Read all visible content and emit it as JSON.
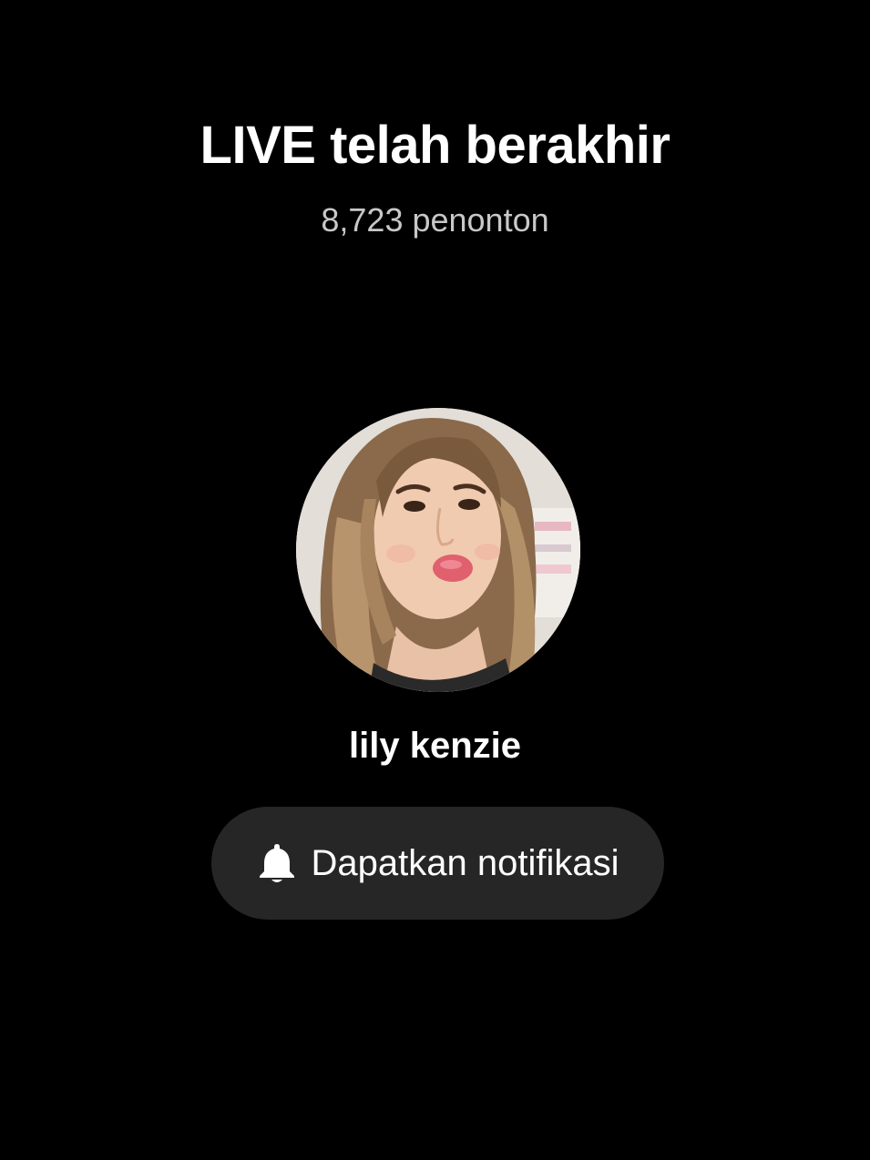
{
  "live_ended": {
    "title": "LIVE telah berakhir",
    "viewers": "8,723 penonton"
  },
  "host": {
    "name": "lily kenzie",
    "avatar_icon": "profile-photo"
  },
  "notify_button": {
    "label": "Dapatkan notifikasi",
    "icon": "bell-icon"
  },
  "colors": {
    "background": "#000000",
    "text_primary": "#ffffff",
    "text_secondary": "#c8c8c8",
    "button_bg": "#262626"
  }
}
